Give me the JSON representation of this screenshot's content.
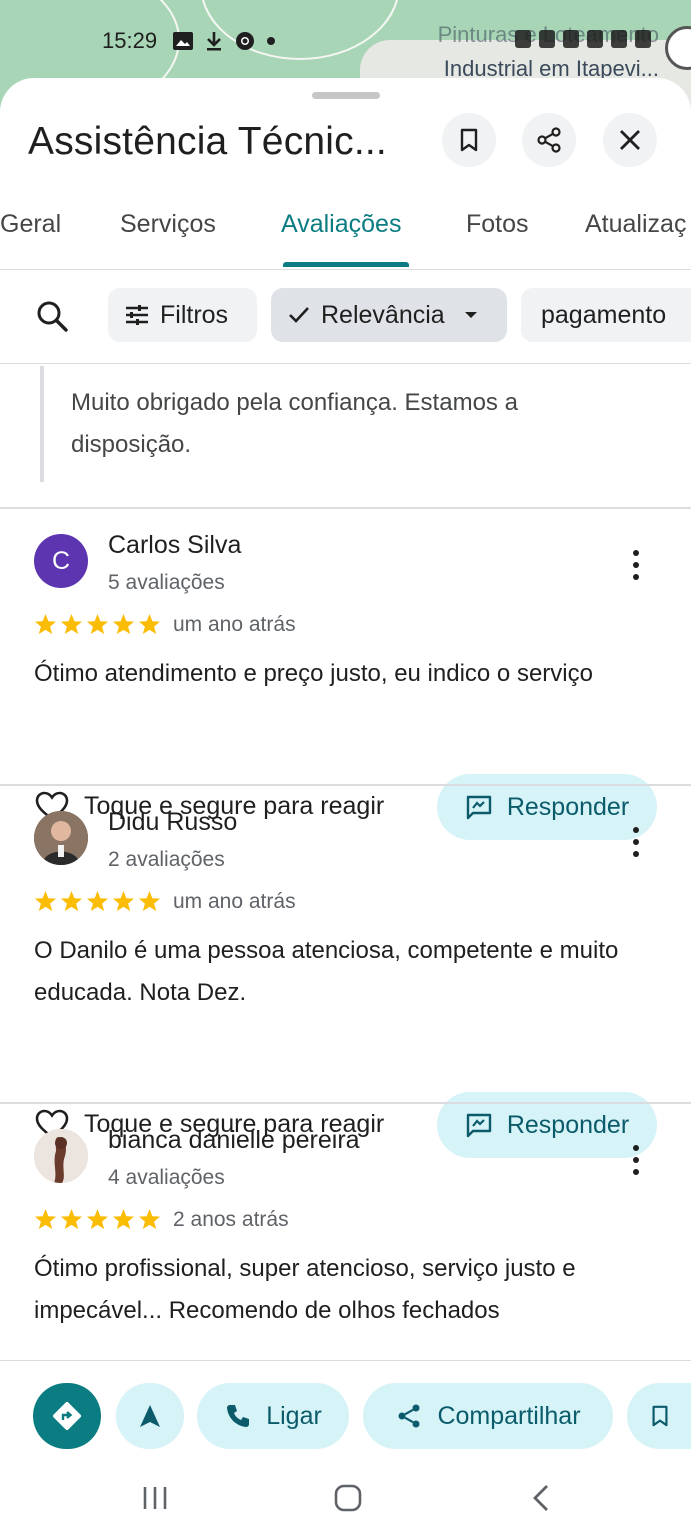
{
  "status_bar": {
    "time": "15:29",
    "map_labels": [
      "Pinturas e Loteamento",
      "Industrial em Itapevi..."
    ]
  },
  "header": {
    "title": "Assistência Técnic...",
    "icons": [
      "bookmark-icon",
      "share-icon",
      "close-icon"
    ]
  },
  "tabs": [
    {
      "label": "Geral",
      "active": false
    },
    {
      "label": "Serviços",
      "active": false
    },
    {
      "label": "Avaliações",
      "active": true
    },
    {
      "label": "Fotos",
      "active": false
    },
    {
      "label": "Atualizaç",
      "active": false
    }
  ],
  "filters": {
    "search_icon": "search-icon",
    "chips": [
      {
        "label": "Filtros",
        "icon": "tune-icon"
      },
      {
        "label": "Relevância",
        "icon": "check-icon",
        "selected": true
      },
      {
        "label": "pagamento",
        "icon": ""
      }
    ]
  },
  "owner_reply": {
    "text": "Muito obrigado pela confiança. Estamos a disposição."
  },
  "reviews": [
    {
      "name": "Carlos Silva",
      "count": "5 avaliações",
      "avatar_letter": "C",
      "avatar_color": "#5e35b1",
      "rating": 5,
      "date": "um ano atrás",
      "text": "Ótimo atendimento e preço justo, eu indico o serviço",
      "react_label": "Toque e segure para reagir",
      "respond_label": "Responder"
    },
    {
      "name": "Didu Russo",
      "count": "2 avaliações",
      "avatar_letter": "",
      "avatar_color": "#6d5a4a",
      "rating": 5,
      "date": "um ano atrás",
      "text": "O Danilo é uma pessoa atenciosa, competente e muito educada. Nota Dez.",
      "react_label": "Toque e segure para reagir",
      "respond_label": "Responder"
    },
    {
      "name": "bianca danielle pereira",
      "count": "4 avaliações",
      "avatar_letter": "",
      "avatar_color": "#d8c8c0",
      "rating": 5,
      "date": "2 anos atrás",
      "text": "Ótimo profissional, super atencioso, serviço justo e impecável... Recomendo de olhos fechados",
      "react_label": "Toque e segure para reagir",
      "respond_label": "Responder"
    }
  ],
  "action_bar": {
    "buttons": [
      {
        "label": "",
        "icon": "directions-icon"
      },
      {
        "label": "",
        "icon": "navigate-icon"
      },
      {
        "label": "Ligar",
        "icon": "phone-icon"
      },
      {
        "label": "Compartilhar",
        "icon": "share-icon"
      },
      {
        "label": "",
        "icon": "bookmark-icon"
      }
    ]
  },
  "colors": {
    "accent": "#0b7d82",
    "chip_bg": "#f0f2f4",
    "respond_bg": "#d6f3f8",
    "star": "#fbbc04"
  }
}
